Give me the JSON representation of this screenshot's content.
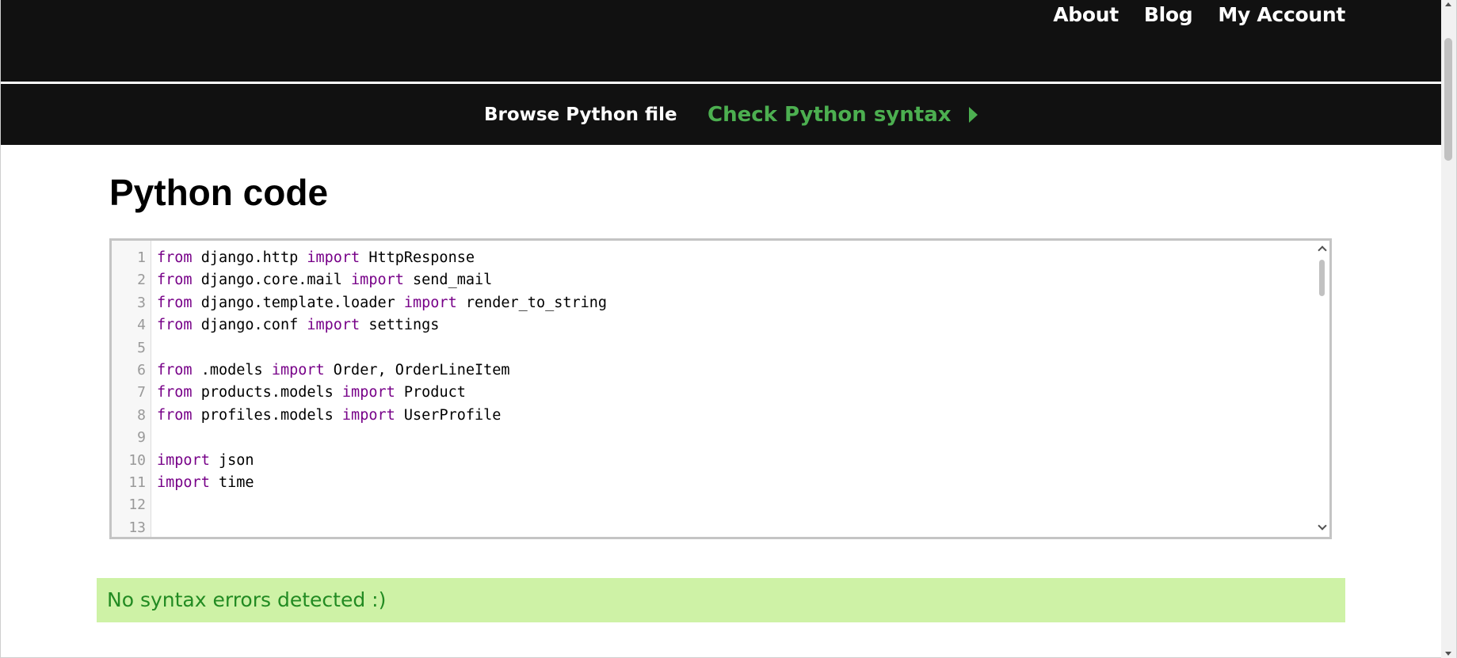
{
  "nav": {
    "items": [
      "About",
      "Blog",
      "My Account"
    ]
  },
  "actions": {
    "browse_label": "Browse Python file",
    "check_label": "Check Python syntax"
  },
  "main": {
    "title": "Python code"
  },
  "editor": {
    "line_numbers": [
      "1",
      "2",
      "3",
      "4",
      "5",
      "6",
      "7",
      "8",
      "9",
      "10",
      "11",
      "12",
      "13"
    ],
    "lines": [
      [
        {
          "t": "from",
          "k": true
        },
        {
          "t": " django.http "
        },
        {
          "t": "import",
          "k": true
        },
        {
          "t": " HttpResponse"
        }
      ],
      [
        {
          "t": "from",
          "k": true
        },
        {
          "t": " django.core.mail "
        },
        {
          "t": "import",
          "k": true
        },
        {
          "t": " send_mail"
        }
      ],
      [
        {
          "t": "from",
          "k": true
        },
        {
          "t": " django.template.loader "
        },
        {
          "t": "import",
          "k": true
        },
        {
          "t": " render_to_string"
        }
      ],
      [
        {
          "t": "from",
          "k": true
        },
        {
          "t": " django.conf "
        },
        {
          "t": "import",
          "k": true
        },
        {
          "t": " settings"
        }
      ],
      [],
      [
        {
          "t": "from",
          "k": true
        },
        {
          "t": " .models "
        },
        {
          "t": "import",
          "k": true
        },
        {
          "t": " Order, OrderLineItem"
        }
      ],
      [
        {
          "t": "from",
          "k": true
        },
        {
          "t": " products.models "
        },
        {
          "t": "import",
          "k": true
        },
        {
          "t": " Product"
        }
      ],
      [
        {
          "t": "from",
          "k": true
        },
        {
          "t": " profiles.models "
        },
        {
          "t": "import",
          "k": true
        },
        {
          "t": " UserProfile"
        }
      ],
      [],
      [
        {
          "t": "import",
          "k": true
        },
        {
          "t": " json"
        }
      ],
      [
        {
          "t": "import",
          "k": true
        },
        {
          "t": " time"
        }
      ],
      [],
      []
    ]
  },
  "result": {
    "message": "No syntax errors detected :)"
  },
  "colors": {
    "header_bg": "#111111",
    "accent_green": "#4caf50",
    "keyword": "#770088",
    "result_bg": "#cef2a6",
    "result_text": "#228b22"
  }
}
